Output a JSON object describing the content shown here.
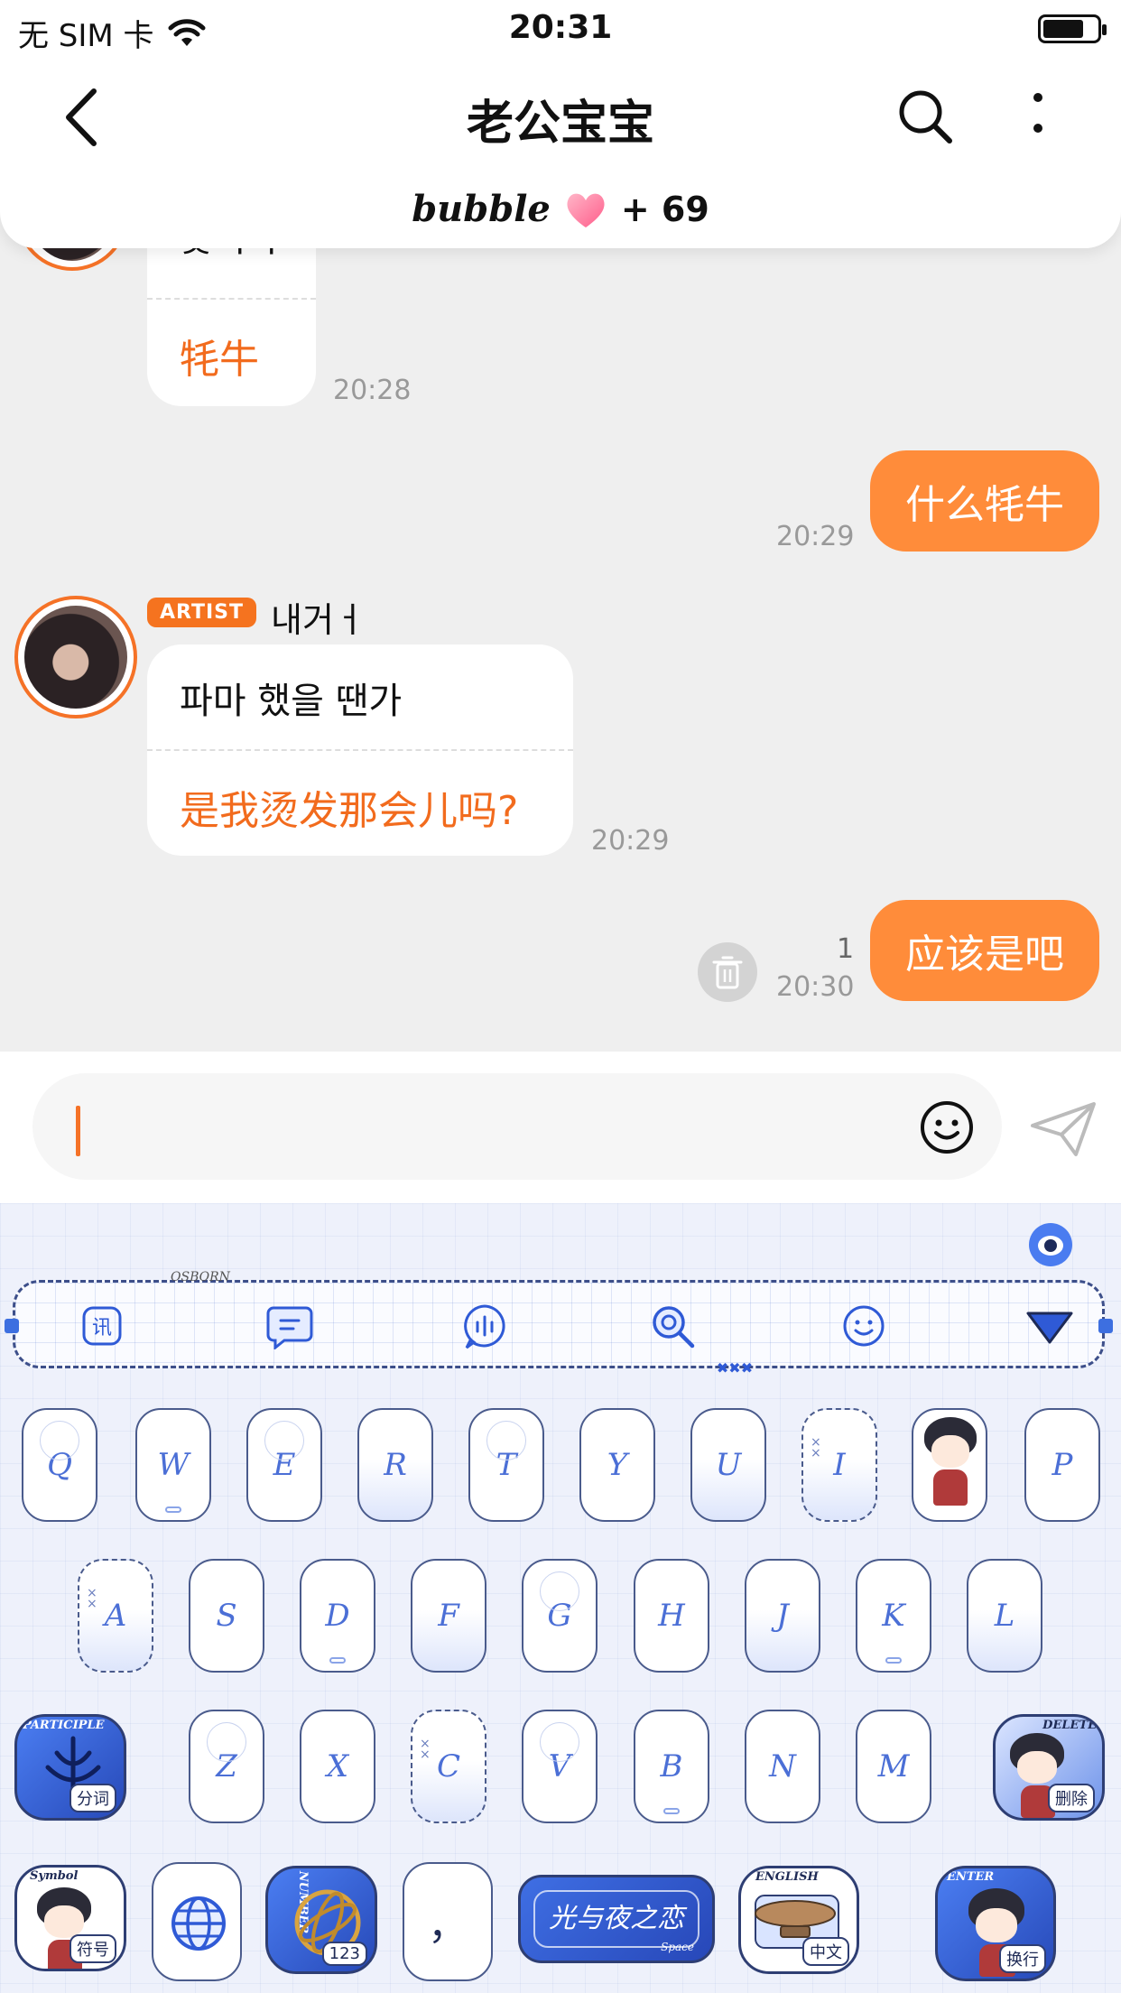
{
  "status_bar": {
    "carrier": "无 SIM 卡",
    "time": "20:31",
    "battery_percent": 70
  },
  "header": {
    "title": "老公宝宝",
    "bubble_brand": "bubble",
    "bubble_count": "+ 69"
  },
  "messages": [
    {
      "side": "left",
      "partial_ko": "웃기다",
      "zh": "牦牛",
      "time": "20:28"
    },
    {
      "side": "right",
      "text": "什么牦牛",
      "time": "20:29"
    },
    {
      "side": "left",
      "badge": "ARTIST",
      "sender": "내거ㅓ",
      "ko": "파마 했을 땐가",
      "zh": "是我烫发那会儿吗?",
      "time": "20:29"
    },
    {
      "side": "right",
      "text": "应该是吧",
      "time": "20:30",
      "unread": "1"
    }
  ],
  "input": {
    "value": ""
  },
  "keyboard": {
    "toolbar_tag": "OSBORN",
    "toolbar_icons": [
      "xun-icon",
      "message-icon",
      "voice-icon",
      "search-icon",
      "smile-icon",
      "collapse-icon"
    ],
    "row1": [
      "Q",
      "W",
      "E",
      "R",
      "T",
      "Y",
      "U",
      "I",
      "",
      "P"
    ],
    "row2": [
      "A",
      "S",
      "D",
      "F",
      "G",
      "H",
      "J",
      "K",
      "L"
    ],
    "row3": [
      "Z",
      "X",
      "C",
      "V",
      "B",
      "N",
      "M"
    ],
    "participle": {
      "tag": "PARTICIPLE",
      "label": "分词"
    },
    "delete": {
      "tag": "DELETE",
      "label": "删除"
    },
    "symbol": {
      "tag": "Symbol",
      "label": "符号"
    },
    "number": {
      "tag": "NUMBER",
      "label": "123"
    },
    "punct": "，",
    "space": {
      "text": "光与夜之恋",
      "sub": "Space"
    },
    "english": {
      "tag": "ENGLISH",
      "label": "中文"
    },
    "enter": {
      "tag": "ENTER",
      "label": "换行"
    }
  },
  "colors": {
    "accent": "#f57227",
    "bubble_right": "#ff8c3a",
    "key_text": "#4b6fd6",
    "kb_bg": "#eef1fb"
  }
}
